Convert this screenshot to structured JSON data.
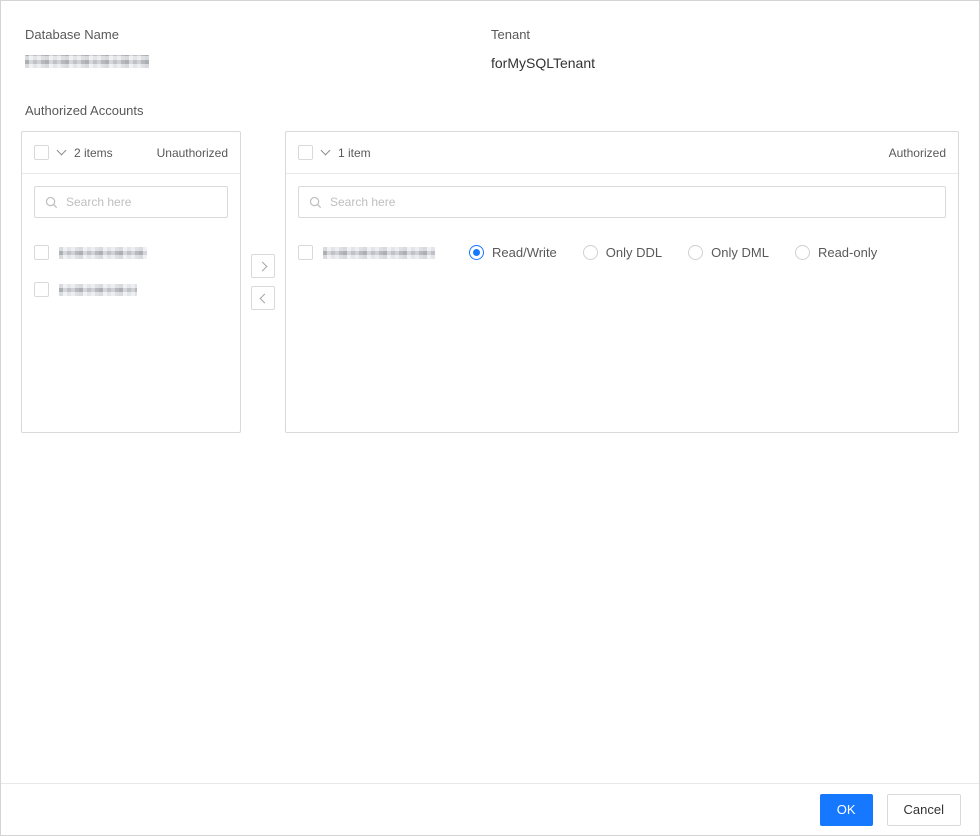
{
  "header": {
    "database_name_label": "Database Name",
    "tenant_label": "Tenant",
    "tenant_value": "forMySQLTenant"
  },
  "section": {
    "authorized_accounts_label": "Authorized Accounts"
  },
  "left_panel": {
    "count_label": "2 items",
    "status_label": "Unauthorized",
    "search_placeholder": "Search here"
  },
  "right_panel": {
    "count_label": "1 item",
    "status_label": "Authorized",
    "search_placeholder": "Search here",
    "permissions": [
      "Read/Write",
      "Only DDL",
      "Only DML",
      "Read-only"
    ],
    "selected_permission": "Read/Write"
  },
  "transfer_buttons": {
    "to_right": ">",
    "to_left": "<"
  },
  "footer": {
    "ok_label": "OK",
    "cancel_label": "Cancel"
  },
  "colors": {
    "accent": "#1677ff"
  }
}
